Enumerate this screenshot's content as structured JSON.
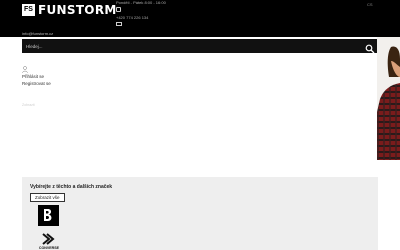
{
  "header": {
    "logo_mark": "FS",
    "brand_name": "FUNSTORM",
    "hours": "Pondělí - Pátek 8:00 - 16:00",
    "phone": "+420 774 226 134",
    "email": "info@funstorm.cz",
    "language": "CS"
  },
  "search": {
    "placeholder": "Hledej..."
  },
  "account": {
    "login": "Přihlásit se",
    "register": "Registrovat se",
    "faint_text": "Zobrazit"
  },
  "brands": {
    "title": "Vybírejte z těchto a dalších značek",
    "show_all": "Zobrazit vše",
    "items": [
      {
        "name": "Burton",
        "logo_text": "BURTON"
      },
      {
        "name": "Converse",
        "logo_text": "CONVERSE"
      }
    ]
  },
  "colors": {
    "topbar": "#000000",
    "searchbar": "#111111",
    "panel": "#eeeeee",
    "accent": "#ffffff"
  }
}
